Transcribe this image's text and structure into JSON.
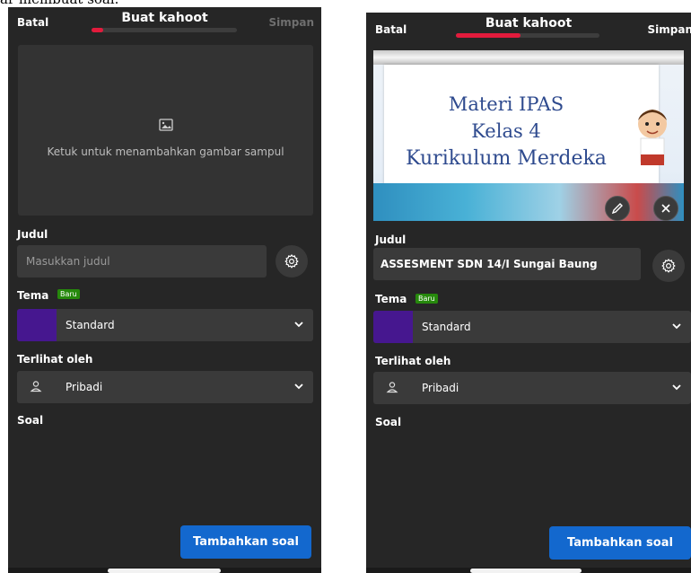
{
  "caption": "ar membuat soal.",
  "colors": {
    "background": "#262626",
    "field": "#3a3a3a",
    "progress_fill": "#e21b3c",
    "badge": "#26890c",
    "theme_swatch": "#46178f",
    "primary_button": "#1368ce"
  },
  "left": {
    "header": {
      "cancel": "Batal",
      "title": "Buat kahoot",
      "save": "Simpan",
      "progress": 0.08
    },
    "cover": {
      "icon": "image-icon",
      "text": "Ketuk untuk menambahkan gambar sampul"
    },
    "title_label": "Judul",
    "title_placeholder": "Masukkan judul",
    "theme_label": "Tema",
    "theme_badge": "Baru",
    "theme_value": "Standard",
    "visibility_label": "Terlihat oleh",
    "visibility_value": "Pribadi",
    "questions_label": "Soal",
    "add_button": "Tambahkan soal"
  },
  "right": {
    "header": {
      "cancel": "Batal",
      "title": "Buat kahoot",
      "save": "Simpan",
      "progress": 0.45
    },
    "cover": {
      "lines": [
        "Materi IPAS",
        "Kelas 4",
        "Kurikulum Merdeka"
      ],
      "edit_icon": "pencil-icon",
      "remove_icon": "close-icon"
    },
    "title_label": "Judul",
    "title_value": "ASSESMENT SDN 14/I Sungai Baung",
    "theme_label": "Tema",
    "theme_badge": "Baru",
    "theme_value": "Standard",
    "visibility_label": "Terlihat oleh",
    "visibility_value": "Pribadi",
    "questions_label": "Soal",
    "add_button": "Tambahkan soal"
  }
}
